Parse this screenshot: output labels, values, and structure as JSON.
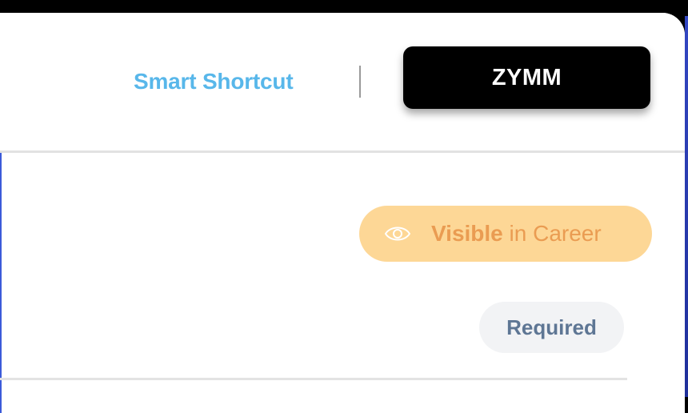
{
  "header": {
    "shortcut_link": "Smart Shortcut",
    "brand_button": "ZYMM"
  },
  "field": {
    "visibility": {
      "strong": "Visible",
      "rest": " in Career",
      "icon": "eye-icon"
    },
    "required_badge": "Required"
  },
  "colors": {
    "link": "#58b7ea",
    "brand_bg": "#000000",
    "visibility_bg": "#fdd796",
    "visibility_text": "#ea9c52",
    "required_bg": "#f2f3f5",
    "required_text": "#5e7694"
  }
}
